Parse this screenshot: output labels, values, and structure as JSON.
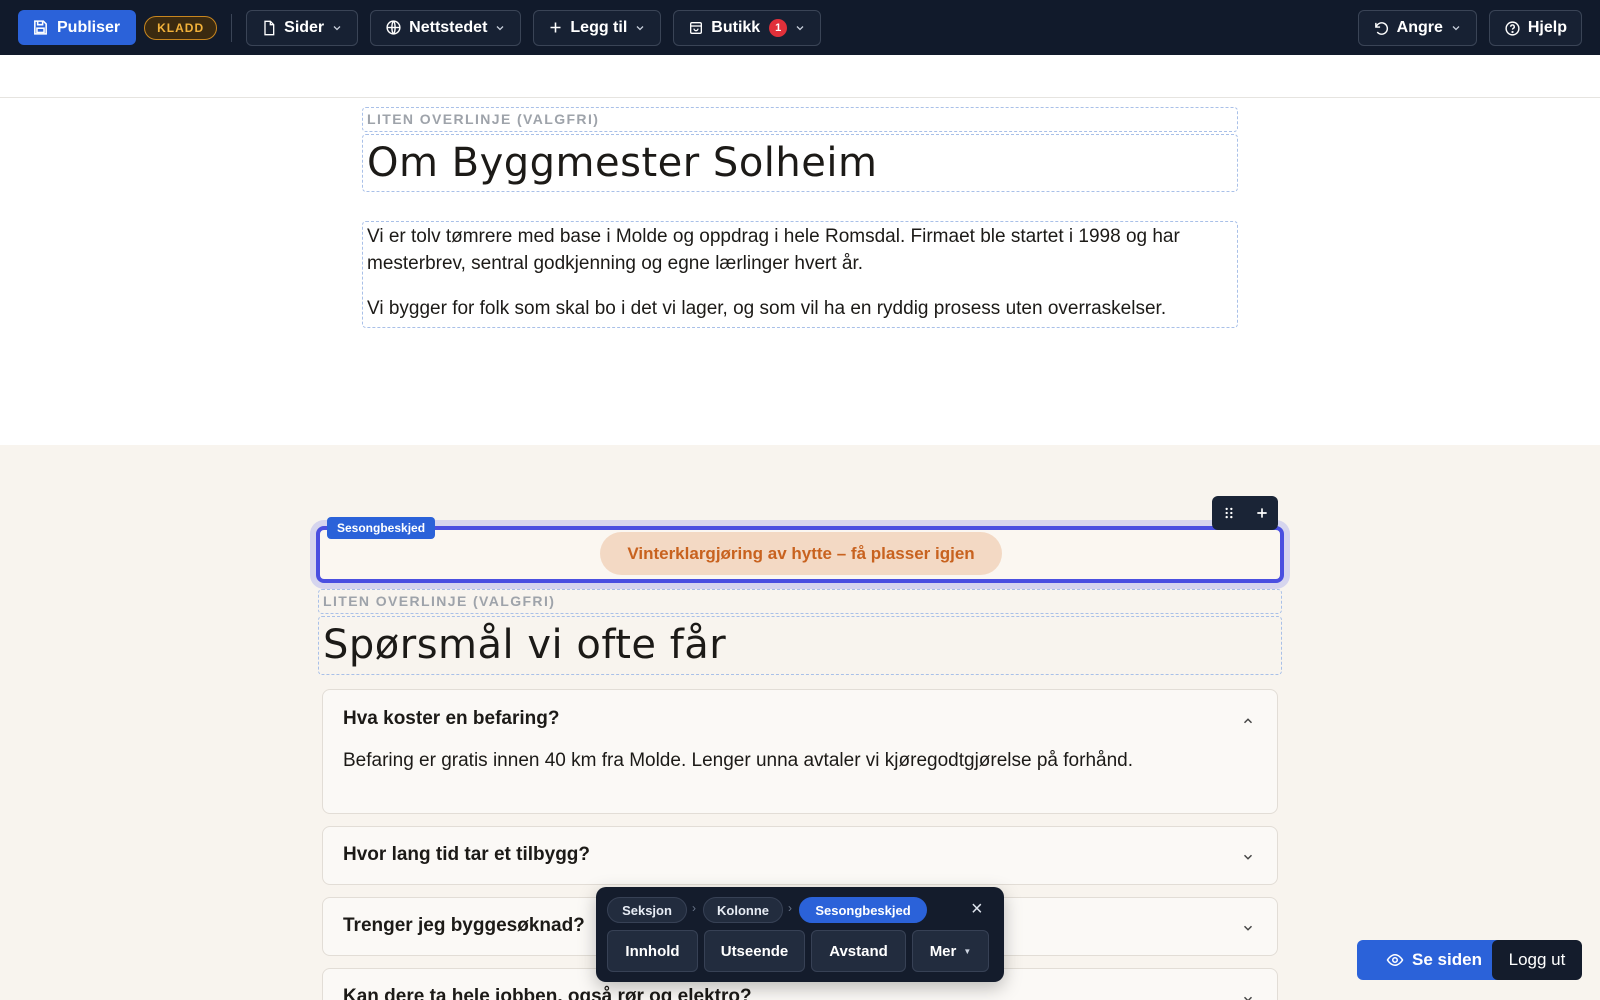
{
  "toolbar": {
    "publish_label": "Publiser",
    "status_badge": "KLADD",
    "pages_label": "Sider",
    "site_label": "Nettstedet",
    "add_label": "Legg til",
    "shop_label": "Butikk",
    "shop_count": "1",
    "undo_label": "Angre",
    "help_label": "Hjelp"
  },
  "about_section": {
    "overline_placeholder": "LITEN OVERLINJE (VALGFRI)",
    "title": "Om Byggmester Solheim",
    "paragraph_1_line_1": "Vi er tolv tømrere med base i Molde og oppdrag i hele Romsdal. Firmaet ble startet i 1998 og har",
    "paragraph_1_line_2": "mesterbrev, sentral godkjenning og egne lærlinger hvert år.",
    "paragraph_2": "Vi bygger for folk som skal bo i det vi lager, og som vil ha en ryddig prosess uten overraskelser."
  },
  "faq_section": {
    "selected_block_label": "Sesongbeskjed",
    "season_message": "Vinterklargjøring av hytte – få plasser igjen",
    "overline_placeholder": "LITEN OVERLINJE (VALGFRI)",
    "title": "Spørsmål vi ofte får",
    "items": [
      {
        "question": "Hva koster en befaring?",
        "answer": "Befaring er gratis innen 40 km fra Molde. Lenger unna avtaler vi kjøregodtgjørelse på forhånd.",
        "expanded": true
      },
      {
        "question": "Hvor lang tid tar et tilbygg?",
        "expanded": false
      },
      {
        "question": "Trenger jeg byggesøknad?",
        "expanded": false
      },
      {
        "question": "Kan dere ta hele jobben, også rør og elektro?",
        "expanded": false
      }
    ]
  },
  "editor_palette": {
    "breadcrumb": [
      "Seksjon",
      "Kolonne",
      "Sesongbeskjed"
    ],
    "tabs": [
      "Innhold",
      "Utseende",
      "Avstand",
      "Mer"
    ],
    "close_glyph": "×"
  },
  "footer_actions": {
    "view_label": "Se siden",
    "logout_label": "Logg ut"
  },
  "colors": {
    "toolbar_bg": "#111a2b",
    "accent": "#2b62d9",
    "selection": "#4a4fe0",
    "season_pill_bg": "#f3d9c4",
    "season_pill_text": "#c8621f"
  }
}
